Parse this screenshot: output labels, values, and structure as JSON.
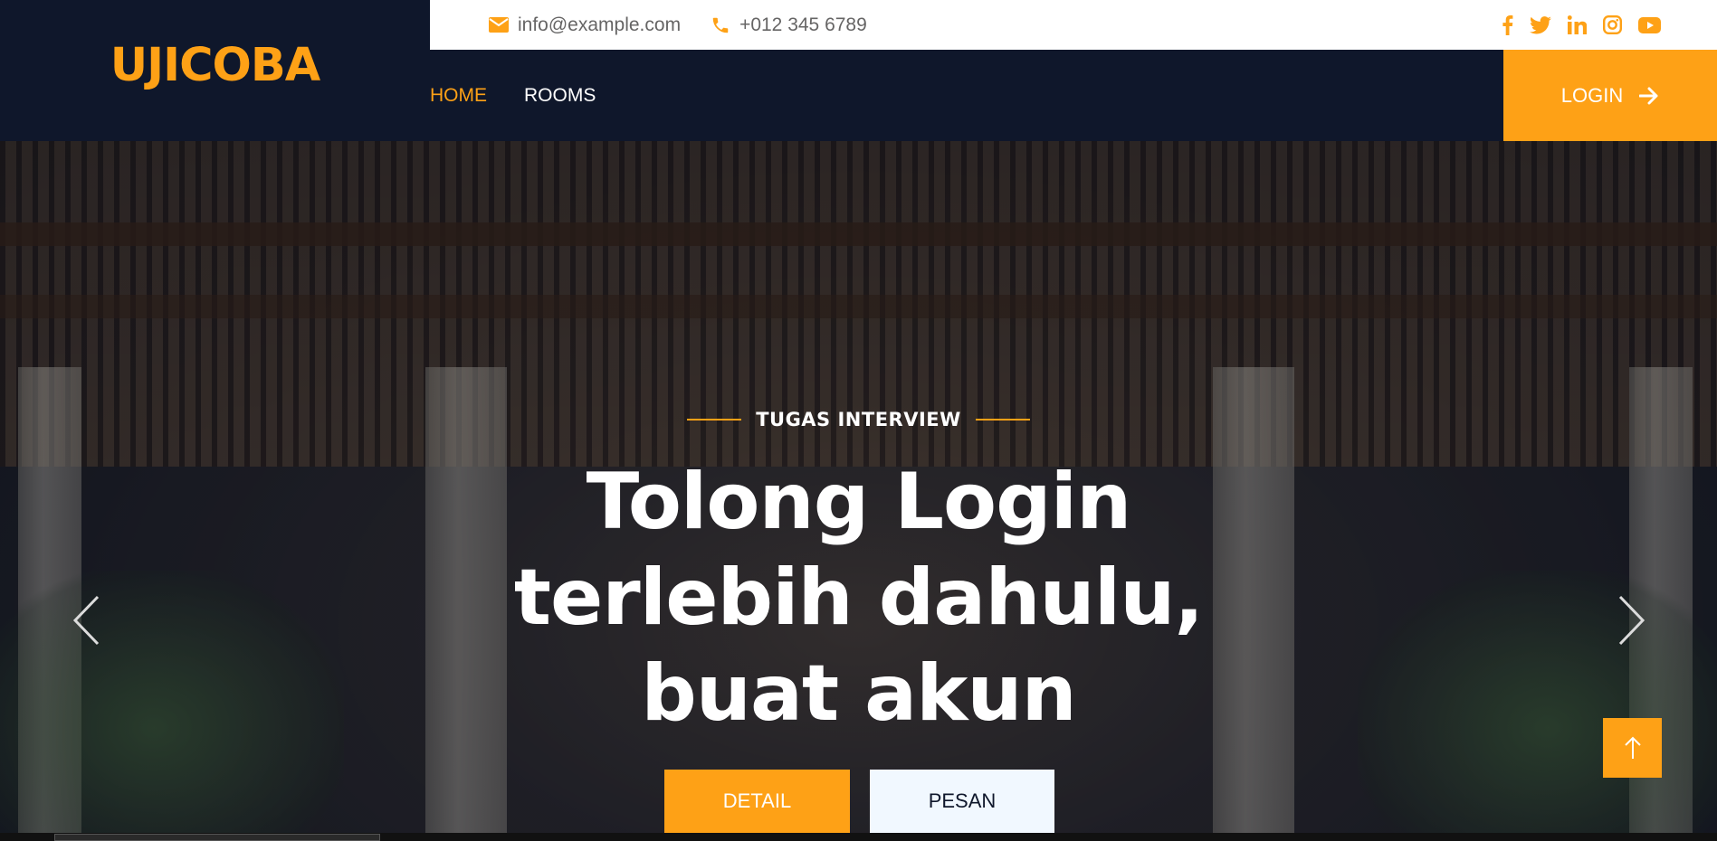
{
  "brand": {
    "name": "UJICOBA"
  },
  "topbar": {
    "email": "info@example.com",
    "phone": "+012 345 6789",
    "socials": [
      "facebook-icon",
      "twitter-icon",
      "linkedin-icon",
      "instagram-icon",
      "youtube-icon"
    ]
  },
  "nav": {
    "items": [
      {
        "label": "HOME",
        "active": true
      },
      {
        "label": "ROOMS",
        "active": false
      }
    ],
    "login_label": "LOGIN"
  },
  "hero": {
    "subtitle": "TUGAS INTERVIEW",
    "headline_lines": [
      "Tolong Login",
      "terlebih dahulu,",
      "buat akun"
    ],
    "detail_label": "DETAIL",
    "pesan_label": "PESAN"
  },
  "colors": {
    "accent": "#fea116",
    "dark": "#0f172b",
    "light_button": "#f1f8ff"
  }
}
